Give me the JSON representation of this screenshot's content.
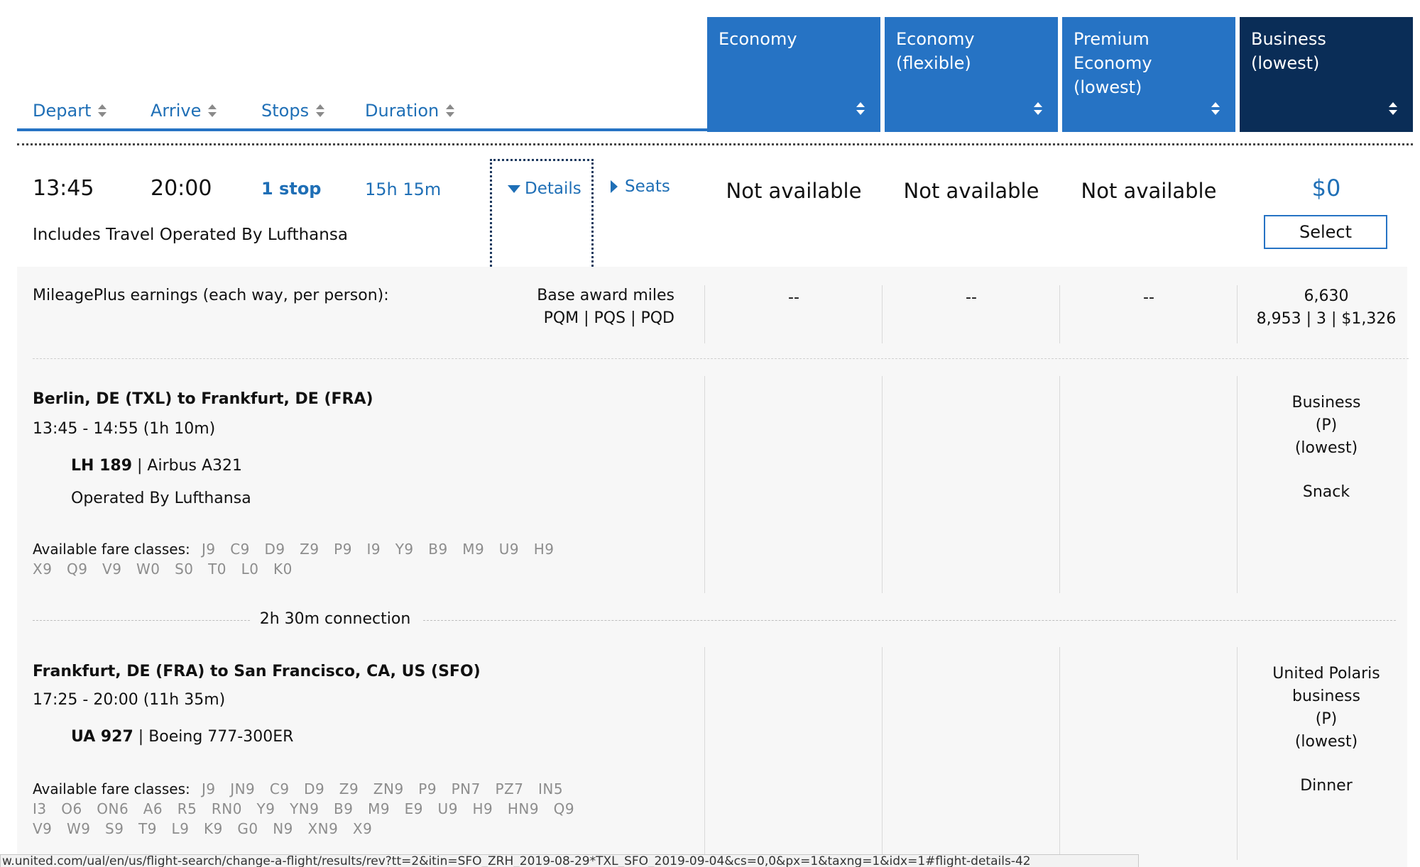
{
  "sort_headers": {
    "depart": "Depart",
    "arrive": "Arrive",
    "stops": "Stops",
    "duration": "Duration"
  },
  "fare_columns": [
    {
      "line1": "Economy",
      "line2": "",
      "line3": ""
    },
    {
      "line1": "Economy",
      "line2": "(flexible)",
      "line3": ""
    },
    {
      "line1": "Premium",
      "line2": "Economy",
      "line3": "(lowest)"
    },
    {
      "line1": "Business",
      "line2": "(lowest)",
      "line3": ""
    }
  ],
  "flight": {
    "depart_time": "13:45",
    "arrive_time": "20:00",
    "stops": "1 stop",
    "duration": "15h 15m",
    "operated_note": "Includes Travel Operated By Lufthansa",
    "details_link": "Details",
    "seats_link": "Seats",
    "fares": [
      "Not available",
      "Not available",
      "Not available"
    ],
    "business_price": "$0",
    "select_label": "Select"
  },
  "earnings": {
    "label": "MileagePlus earnings (each way, per person):",
    "base_label": "Base award miles",
    "pq_label": "PQM | PQS | PQD",
    "dashes": [
      "--",
      "--",
      "--"
    ],
    "business_miles": "6,630",
    "business_pq": "8,953 | 3 | $1,326"
  },
  "segment1": {
    "route": "Berlin, DE (TXL) to Frankfurt, DE (FRA)",
    "times": "13:45 - 14:55 (1h 10m)",
    "flight_no": "LH 189",
    "aircraft": "| Airbus A321",
    "operated": "Operated By Lufthansa",
    "fare_label": "Available fare classes:",
    "fare_classes_1": "J9   C9   D9   Z9   P9   I9   Y9   B9   M9   U9   H9",
    "fare_classes_2": "X9   Q9   V9   W0   S0   T0   L0   K0",
    "cabin": [
      "Business",
      "(P)",
      "(lowest)"
    ],
    "meal": "Snack"
  },
  "connection": "2h 30m connection",
  "segment2": {
    "route": "Frankfurt, DE (FRA) to San Francisco, CA, US (SFO)",
    "times": "17:25 - 20:00 (11h 35m)",
    "flight_no": "UA 927",
    "aircraft": "| Boeing 777-300ER",
    "fare_label": "Available fare classes:",
    "fare_classes_1": "J9   JN9   C9   D9   Z9   ZN9   P9   PN7   PZ7   IN5",
    "fare_classes_2": "I3   O6   ON6   A6   R5   RN0   Y9   YN9   B9   M9   E9   U9   H9   HN9   Q9",
    "fare_classes_3": "V9   W9   S9   T9   L9   K9   G0   N9   XN9   X9",
    "cabin": [
      "United Polaris",
      "business",
      "(P)",
      "(lowest)"
    ],
    "meal": "Dinner"
  },
  "status_bar": "w.united.com/ual/en/us/flight-search/change-a-flight/results/rev?tt=2&itin=SFO_ZRH_2019-08-29*TXL_SFO_2019-09-04&cs=0,0&px=1&taxng=1&idx=1#flight-details-42"
}
